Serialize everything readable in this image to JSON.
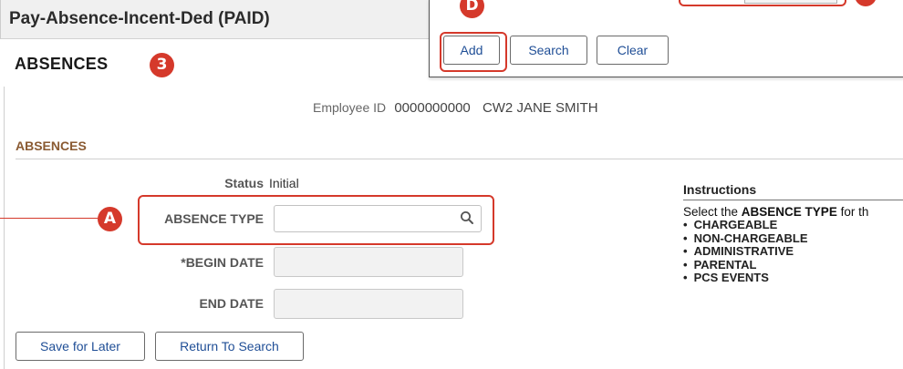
{
  "header": {
    "title": "Pay-Absence-Incent-Ded (PAID)"
  },
  "page": {
    "heading": "ABSENCES"
  },
  "employee": {
    "label": "Employee ID",
    "id": "0000000000",
    "name": "CW2 JANE SMITH"
  },
  "section": {
    "title": "ABSENCES"
  },
  "form": {
    "status_label": "Status",
    "status_value": "Initial",
    "absence_type_label": "ABSENCE TYPE",
    "absence_type_value": "",
    "begin_date_label": "*BEGIN DATE",
    "end_date_label": "END DATE"
  },
  "buttons": {
    "save_for_later": "Save for Later",
    "return_to_search": "Return To Search"
  },
  "popup": {
    "add": "Add",
    "search": "Search",
    "clear": "Clear"
  },
  "instructions": {
    "title": "Instructions",
    "text_prefix": "Select the ",
    "text_bold": "ABSENCE TYPE",
    "text_suffix": " for th",
    "items": [
      "CHARGEABLE",
      "NON-CHARGEABLE",
      "ADMINISTRATIVE",
      "PARENTAL",
      "PCS EVENTS"
    ]
  },
  "callouts": {
    "page": "3",
    "a": "A",
    "d": "D"
  },
  "colors": {
    "accent_red": "#d5392b",
    "section_brown": "#8a5a32",
    "button_blue": "#1f4e96"
  },
  "icons": {
    "lookup": "search-icon"
  }
}
